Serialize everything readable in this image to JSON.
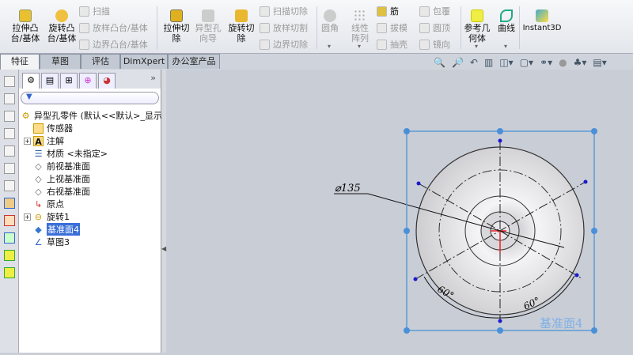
{
  "ribbon": {
    "extrude_boss": "拉伸凸台/基体",
    "revolve_boss": "旋转凸台/基体",
    "sweep": "扫描",
    "loft": "放样凸台/基体",
    "boundary": "边界凸台/基体",
    "extrude_cut": "拉伸切除",
    "hole_wizard": "异型孔向导",
    "revolve_cut": "旋转切除",
    "swept_cut": "扫描切除",
    "lofted_cut": "放样切割",
    "boundary_cut": "边界切除",
    "fillet": "圆角",
    "linear_pattern": "线性阵列",
    "rib": "筋",
    "draft": "拔模",
    "shell": "抽壳",
    "wrap": "包覆",
    "dome": "圆顶",
    "mirror": "镜向",
    "ref_geometry": "参考几何体",
    "curves": "曲线",
    "instant3d": "Instant3D"
  },
  "tabs": [
    {
      "label": "特征"
    },
    {
      "label": "草图"
    },
    {
      "label": "评估"
    },
    {
      "label": "DimXpert"
    },
    {
      "label": "办公室产品"
    }
  ],
  "tree": {
    "root": "异型孔零件  (默认<<默认>_显示",
    "items": [
      {
        "label": "传感器"
      },
      {
        "label": "注解"
      },
      {
        "label": "材质 <未指定>"
      },
      {
        "label": "前视基准面"
      },
      {
        "label": "上视基准面"
      },
      {
        "label": "右视基准面"
      },
      {
        "label": "原点"
      },
      {
        "label": "旋转1"
      },
      {
        "label": "基准面4"
      },
      {
        "label": "草图3"
      }
    ],
    "expand_more": "»"
  },
  "graphics": {
    "diameter_dim": "⌀135",
    "angle1": "60°",
    "angle2": "60°",
    "plane_label": "基准面4"
  },
  "colors": {
    "plane": "#5b9bd5",
    "selection": "#3a6fd8"
  }
}
